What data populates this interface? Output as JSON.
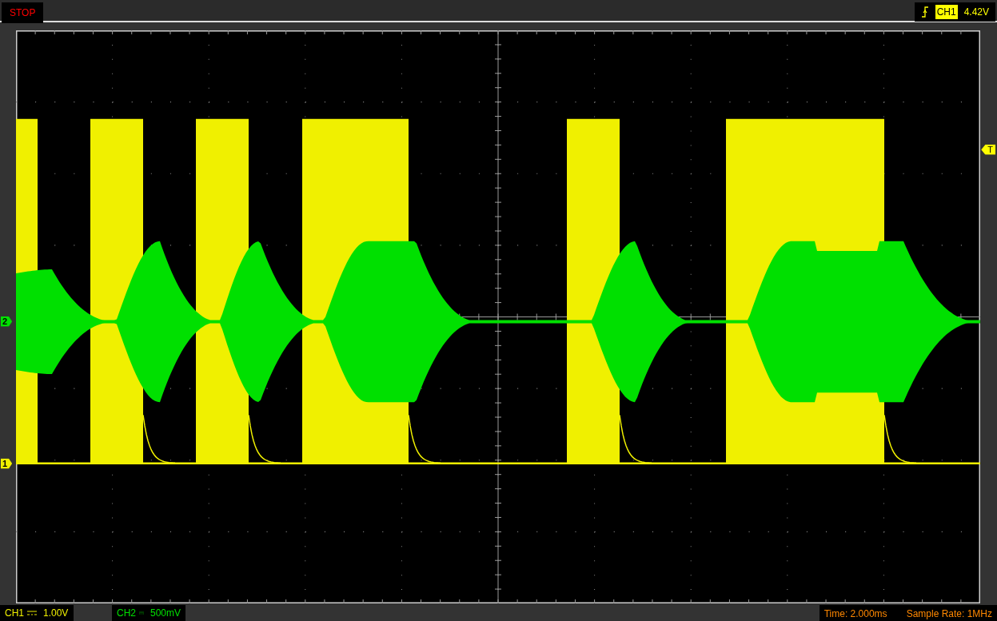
{
  "top_bar": {
    "run_state": "STOP",
    "trigger": {
      "channel": "CH1",
      "level": "4.42V"
    }
  },
  "markers": [
    {
      "label": "2",
      "color": "#00e000"
    },
    {
      "label": "1",
      "color": "#f0f000"
    }
  ],
  "trigger_marker": "T",
  "channels": [
    {
      "name": "CH1",
      "scale": "1.00V",
      "color": "#f0f000"
    },
    {
      "name": "CH2",
      "scale": "500mV",
      "color": "#00e000"
    }
  ],
  "timebase": "Time: 2.000ms",
  "sample_rate": "Sample Rate: 1MHz"
}
